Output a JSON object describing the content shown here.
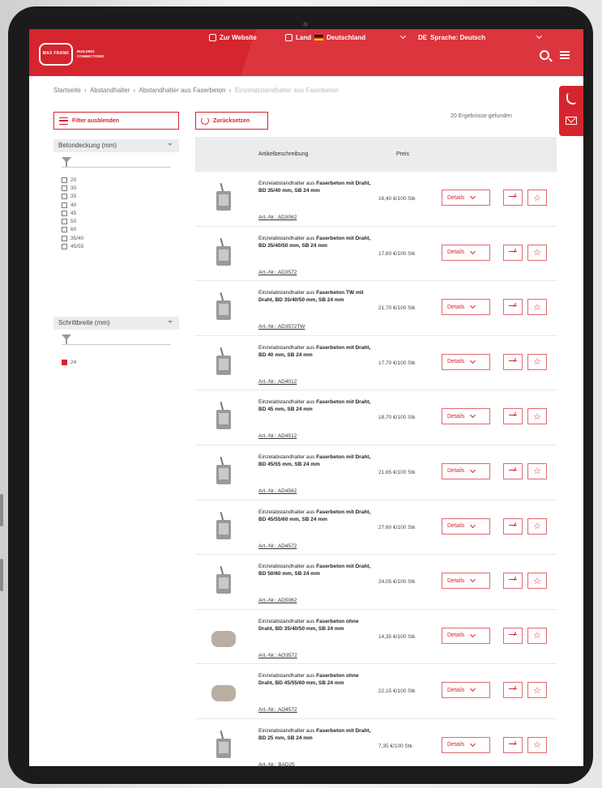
{
  "header": {
    "logo_name": "MAX FRANK",
    "logo_tagline_1": "BUILDING",
    "logo_tagline_2": "CONNECTIONS",
    "nav_website": "Zur Website",
    "nav_country_label": "Land",
    "nav_country_value": "Deutschland",
    "nav_language": "Sprache: Deutsch",
    "nav_language_code": "DE",
    "brand_color": "#d5252f"
  },
  "breadcrumb": [
    "Startseite",
    "Abstandhalter",
    "Abstandhalter aus Faserbeton",
    "Einzelabstandhalter aus Faserbeton"
  ],
  "sidebar": {
    "hide_filter_label": "Filter ausblenden",
    "filters": [
      {
        "title": "Betondeckung (mm)",
        "options": [
          {
            "label": "20",
            "checked": false
          },
          {
            "label": "30",
            "checked": false
          },
          {
            "label": "35",
            "checked": false
          },
          {
            "label": "40",
            "checked": false
          },
          {
            "label": "45",
            "checked": false
          },
          {
            "label": "50",
            "checked": false
          },
          {
            "label": "60",
            "checked": false
          },
          {
            "label": "35/40",
            "checked": false
          },
          {
            "label": "45/55",
            "checked": false
          }
        ]
      },
      {
        "title": "Schrittbreite (mm)",
        "options": [
          {
            "label": "24",
            "checked": true
          }
        ]
      }
    ]
  },
  "toolbar": {
    "reset_label": "Zurücksetzen",
    "results_count": "20 Ergebnisse gefunden"
  },
  "table": {
    "col_article": "Artikelbeschreibung",
    "col_price": "Preis",
    "details_label": "Details",
    "rows": [
      {
        "title": "Einzelabstandhalter aus",
        "bold": "Faserbeton mit Draht, BD 35/40 mm, SB 24 mm",
        "artnr": "Art.-Nr.: AD3062",
        "price": "16,40 €/100 Stk"
      },
      {
        "title": "Einzelabstandhalter aus",
        "bold": "Faserbeton mit Draht, BD 35/40/50 mm, SB 24 mm",
        "artnr": "Art.-Nr.: AD3572",
        "price": "17,60 €/100 Stk"
      },
      {
        "title": "Einzelabstandhalter aus",
        "bold": "Faserbeton TW mit Draht, BD 35/40/50 mm, SB 24 mm",
        "artnr": "Art.-Nr.: AD3572TW",
        "price": "21,70 €/100 Stk"
      },
      {
        "title": "Einzelabstandhalter aus",
        "bold": "Faserbeton mit Draht, BD 40 mm, SB 24 mm",
        "artnr": "Art.-Nr.: AD4012",
        "price": "17,70 €/100 Stk"
      },
      {
        "title": "Einzelabstandhalter aus",
        "bold": "Faserbeton mit Draht, BD 45 mm, SB 24 mm",
        "artnr": "Art.-Nr.: AD4512",
        "price": "18,70 €/100 Stk"
      },
      {
        "title": "Einzelabstandhalter aus",
        "bold": "Faserbeton mit Draht, BD 45/55 mm, SB 24 mm",
        "artnr": "Art.-Nr.: AD4562",
        "price": "21,65 €/100 Stk"
      },
      {
        "title": "Einzelabstandhalter aus",
        "bold": "Faserbeton mit Draht, BD 45/55/60 mm, SB 24 mm",
        "artnr": "Art.-Nr.: AD4572",
        "price": "27,60 €/100 Stk"
      },
      {
        "title": "Einzelabstandhalter aus",
        "bold": "Faserbeton mit Draht, BD 50/60 mm, SB 24 mm",
        "artnr": "Art.-Nr.: AD5062",
        "price": "24,05 €/100 Stk"
      },
      {
        "title": "Einzelabstandhalter aus",
        "bold": "Faserbeton ohne Draht, BD 35/40/50 mm, SB 24 mm",
        "artnr": "Art.-Nr.: AO3572",
        "price": "14,35 €/100 Stk"
      },
      {
        "title": "Einzelabstandhalter aus",
        "bold": "Faserbeton ohne Draht, BD 45/55/60 mm, SB 24 mm",
        "artnr": "Art.-Nr.: AO4572",
        "price": "22,15 €/100 Stk"
      },
      {
        "title": "Einzelabstandhalter aus",
        "bold": "Faserbeton mit Draht, BD 25 mm, SB 24 mm",
        "artnr": "Art.-Nr.: BAD25",
        "price": "7,35 €/100 Stk"
      }
    ]
  }
}
